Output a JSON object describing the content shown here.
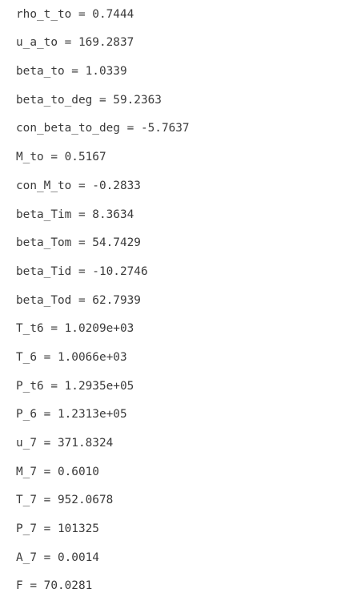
{
  "output": {
    "lines": [
      "rho_t_to = 0.7444",
      "u_a_to = 169.2837",
      "beta_to = 1.0339",
      "beta_to_deg = 59.2363",
      "con_beta_to_deg = -5.7637",
      "M_to = 0.5167",
      "con_M_to = -0.2833",
      "beta_Tim = 8.3634",
      "beta_Tom = 54.7429",
      "beta_Tid = -10.2746",
      "beta_Tod = 62.7939",
      "T_t6 = 1.0209e+03",
      "T_6 = 1.0066e+03",
      "P_t6 = 1.2935e+05",
      "P_6 = 1.2313e+05",
      "u_7 = 371.8324",
      "M_7 = 0.6010",
      "T_7 = 952.0678",
      "P_7 = 101325",
      "A_7 = 0.0014",
      "F = 70.0281"
    ]
  }
}
